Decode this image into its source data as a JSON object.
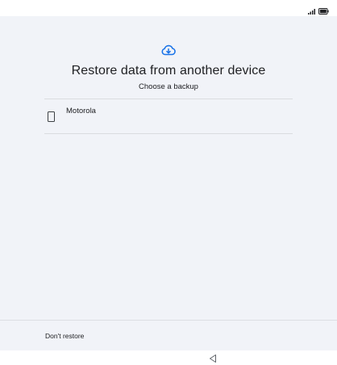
{
  "status_bar": {
    "icons": [
      "signal-icon",
      "battery-icon"
    ]
  },
  "header": {
    "icon": "cloud-download-icon",
    "title": "Restore data from another device",
    "subtitle": "Choose a backup"
  },
  "backups": [
    {
      "icon": "phone-icon",
      "label": "Motorola"
    }
  ],
  "footer": {
    "dont_restore_label": "Don't restore"
  },
  "nav_bar": {
    "back_icon": "back-triangle-icon"
  },
  "colors": {
    "accent": "#1a73e8",
    "background": "#f1f3f8",
    "text": "#202124",
    "divider": "#dadce0"
  }
}
